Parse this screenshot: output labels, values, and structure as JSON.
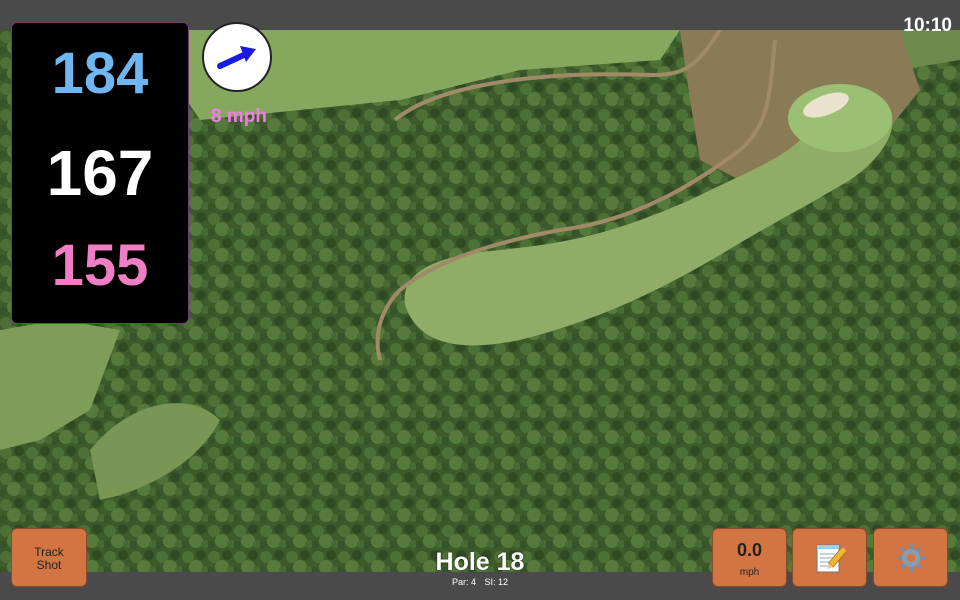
{
  "status": {
    "clock": "10:10"
  },
  "yardages": {
    "back": "184",
    "center": "167",
    "front": "155"
  },
  "wind": {
    "speed_label": "8 mph",
    "direction_icon": "arrow-up-right-icon"
  },
  "hole": {
    "title": "Hole 18",
    "par_label": "Par: 4",
    "si_label": "SI: 12"
  },
  "buttons": {
    "track_shot_line1": "Track",
    "track_shot_line2": "Shot",
    "wind_value": "0.0",
    "wind_unit": "mph",
    "notes_icon": "notepad-pencil-icon",
    "settings_icon": "gear-icon"
  },
  "colors": {
    "back_yardage": "#6fb6f2",
    "center_yardage": "#ffffff",
    "front_yardage": "#f07ec4",
    "wind_label": "#f07ee6",
    "arrow": "#1a1ae0",
    "button_fill": "#d27543",
    "panel_bg": "#000000",
    "bar_bg": "#4a4a4a"
  }
}
